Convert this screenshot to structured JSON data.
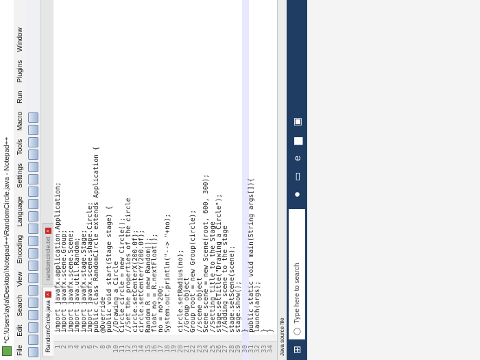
{
  "window": {
    "title": "*C:\\Users\\ayla\\Desktop\\Notepad++\\RandomCircle.java - Notepad++"
  },
  "menu": [
    "File",
    "Edit",
    "Search",
    "View",
    "Encoding",
    "Language",
    "Settings",
    "Tools",
    "Macro",
    "Run",
    "Plugins",
    "Window"
  ],
  "tabs": [
    {
      "label": "RandomCircle.java"
    },
    {
      "label": "randomcircle.txt"
    }
  ],
  "toolbar_icons": [
    "new-file-icon",
    "open-folder-icon",
    "save-icon",
    "save-all-icon",
    "close-icon",
    "close-all-icon",
    "print-icon",
    "cut-icon",
    "copy-icon",
    "paste-icon",
    "undo-icon",
    "redo-icon",
    "find-icon",
    "replace-icon",
    "zoom-in-icon",
    "zoom-out-icon",
    "sync-icon",
    "wrap-icon",
    "indent-icon",
    "record-macro-icon"
  ],
  "code": [
    {
      "n": "1",
      "t": "import javafx.application.Application;"
    },
    {
      "n": "2",
      "t": "import javafx.scene.Group;"
    },
    {
      "n": "3",
      "t": "import javafx.scene.Scene;"
    },
    {
      "n": "4",
      "t": "import java.util.Random;"
    },
    {
      "n": "5",
      "t": "import javafx.stage.Stage;"
    },
    {
      "n": "6",
      "t": "import javafx.scene.shape.Circle;"
    },
    {
      "n": "7",
      "t": "public class RandomCircle extends Application {"
    },
    {
      "n": "8",
      "t": "@Override"
    },
    {
      "n": "9",
      "t": "public void start(Stage stage) {"
    },
    {
      "n": "10",
      "t": "//Drawing a Circle"
    },
    {
      "n": "11",
      "t": "Circle circle = new Circle();"
    },
    {
      "n": "12",
      "t": "//Set the properties of the circle"
    },
    {
      "n": "13",
      "t": "circle.setCenterX(200.0f);"
    },
    {
      "n": "14",
      "t": "circle.setCenterY(200.0f);"
    },
    {
      "n": "15",
      "t": "Random R = new Random();"
    },
    {
      "n": "16",
      "t": "float no = R.nextFloat();"
    },
    {
      "n": "17",
      "t": "no = no*200;"
    },
    {
      "n": "18",
      "t": "System.out.println(\"--> \"+no);"
    },
    {
      "n": "19",
      "t": ""
    },
    {
      "n": "20",
      "t": "circle.setRadius(no);"
    },
    {
      "n": "21",
      "t": "//Group object"
    },
    {
      "n": "22",
      "t": "Group root = new Group(circle);"
    },
    {
      "n": "23",
      "t": "//scene object"
    },
    {
      "n": "24",
      "t": "Scene scene = new Scene(root, 600, 300);"
    },
    {
      "n": "25",
      "t": "//Setting title to the Stage"
    },
    {
      "n": "26",
      "t": "stage.setTitle(\"Drawing a Circle\");"
    },
    {
      "n": "27",
      "t": "//Adding scene to the stage"
    },
    {
      "n": "28",
      "t": "stage.setScene(scene);"
    },
    {
      "n": "29",
      "t": "stage.show();"
    },
    {
      "n": "30",
      "t": "}"
    },
    {
      "n": "31",
      "t": "public static void main(String args[]){"
    },
    {
      "n": "32",
      "t": "launch(args);"
    },
    {
      "n": "33",
      "t": "}"
    },
    {
      "n": "34",
      "t": "}"
    }
  ],
  "status": {
    "file_type": "Java source file"
  },
  "taskbar": {
    "search_placeholder": "Type here to search"
  },
  "colors": {
    "taskbar": "#1f3d63",
    "current_line": "#e8e8ff"
  }
}
